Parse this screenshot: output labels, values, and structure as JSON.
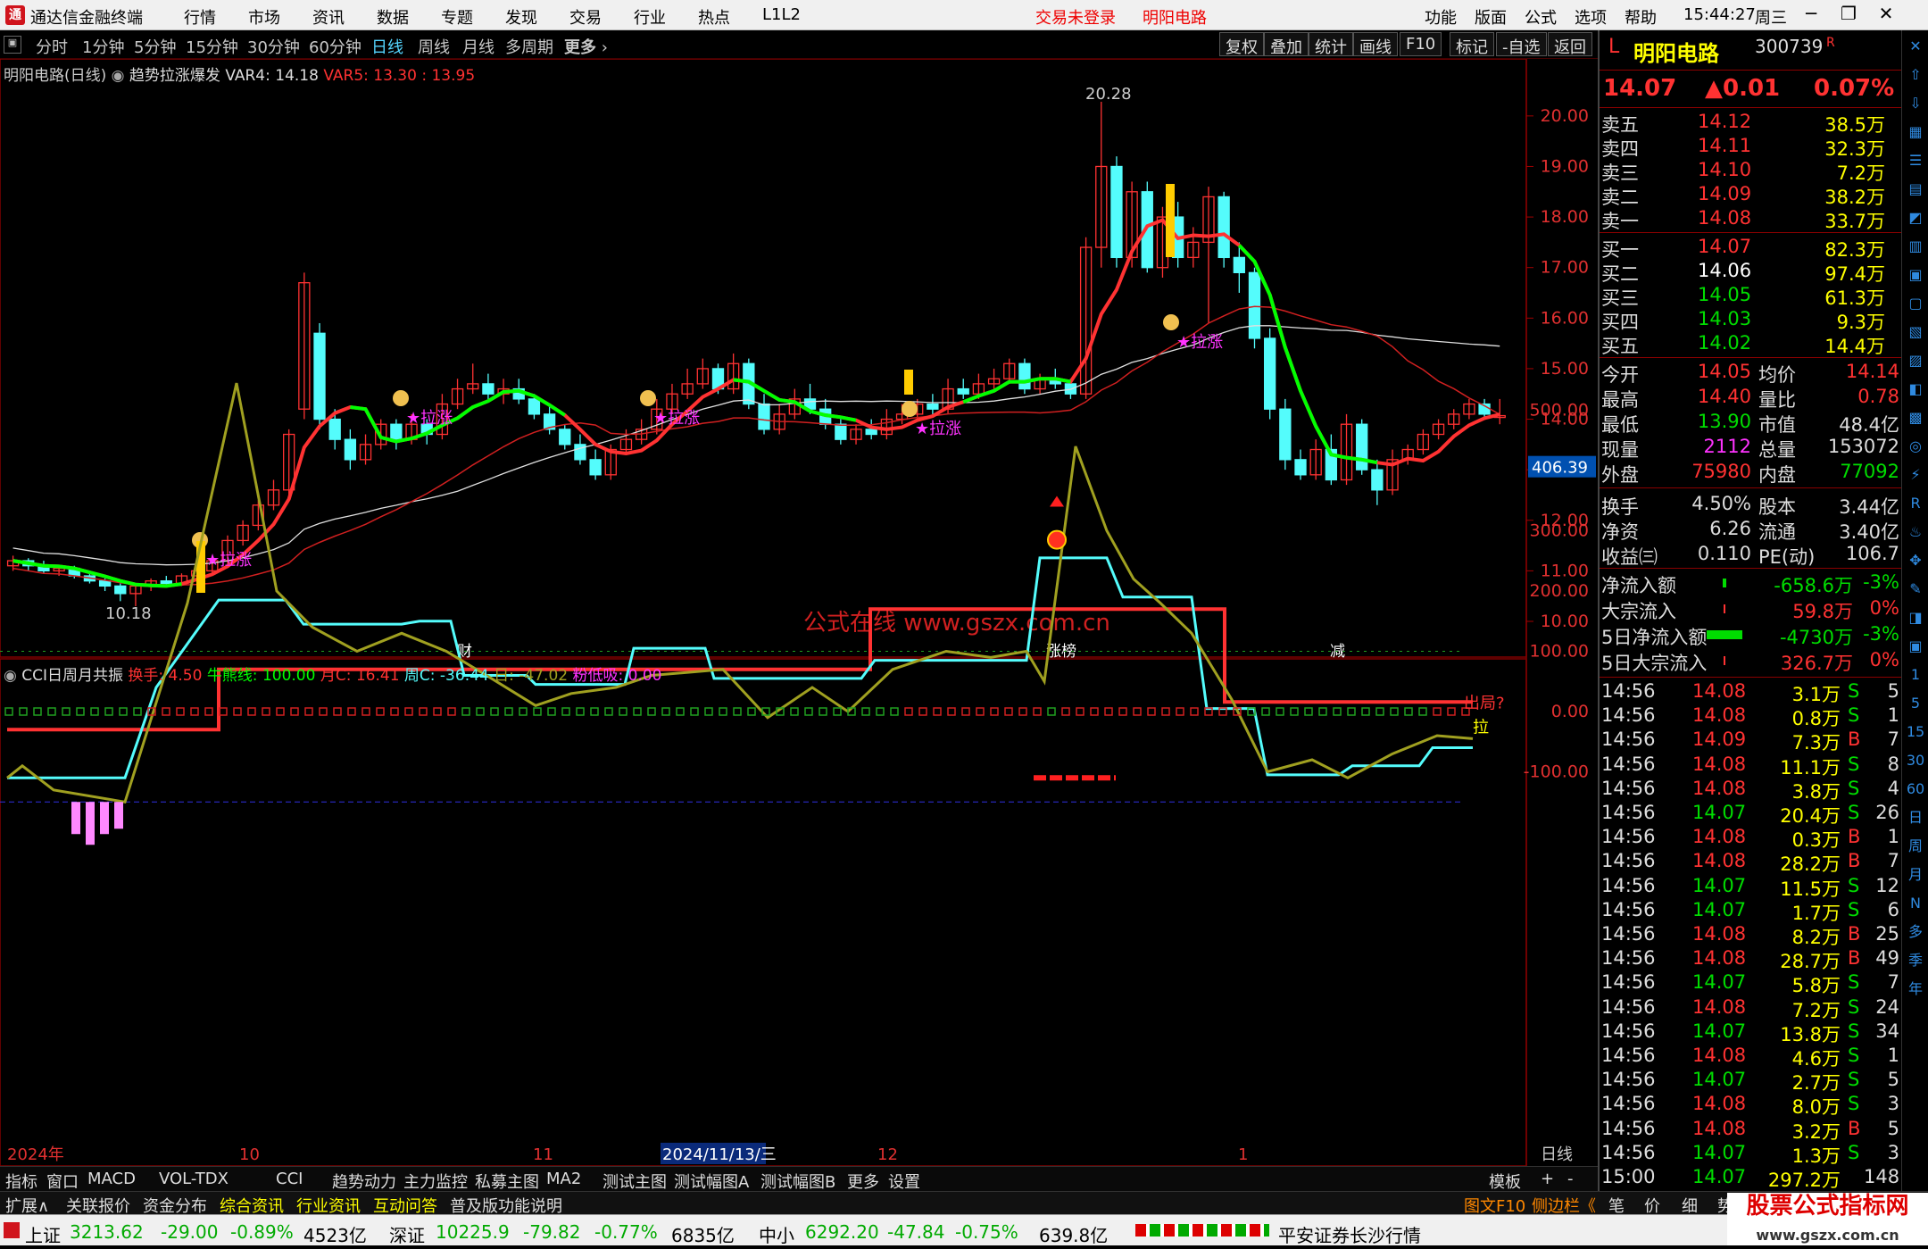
{
  "app": {
    "name": "通达信金融终端",
    "menus": [
      "行情",
      "市场",
      "资讯",
      "数据",
      "专题",
      "发现",
      "交易",
      "行业",
      "热点",
      "L1L2"
    ],
    "login_status": "交易未登录",
    "stock_title": "明阳电路",
    "right_menus": [
      "功能",
      "版面",
      "公式",
      "选项",
      "帮助"
    ],
    "time": "15:44:27",
    "weekday": "周三"
  },
  "toolbar": {
    "periods": [
      "分时",
      "1分钟",
      "5分钟",
      "15分钟",
      "30分钟",
      "60分钟",
      "日线",
      "周线",
      "月线",
      "多周期",
      "更多"
    ],
    "active": "日线",
    "tools": [
      "复权",
      "叠加",
      "统计",
      "画线",
      "F10",
      "标记",
      "-自选",
      "返回"
    ]
  },
  "main_chart": {
    "stock_label": "明阳电路(日线)",
    "indicator": "趋势拉涨爆发",
    "var4": "VAR4: 14.18",
    "var5": "VAR5: 13.30",
    "var5_tail": ": 13.95",
    "high_label": "20.28",
    "low_label": "10.18",
    "y_ticks": [
      "20.00",
      "19.00",
      "18.00",
      "17.00",
      "16.00",
      "15.00",
      "14.00",
      "13.00",
      "12.00",
      "11.00",
      "10.00"
    ],
    "signal_label": "★拉涨",
    "watermark": "公式在线  www.gszx.com.cn",
    "events": [
      "财",
      "涨榜",
      "减"
    ]
  },
  "sub_chart": {
    "title": "CCI日周月共振",
    "huanshou": "换手: 4.50",
    "niuxiong": "牛熊线: 100.00",
    "monthC": "月C: 16.41",
    "weekC": "周C: -36.44",
    "dayC": "日: -47.02",
    "fendixi": "粉低吸: 0.00",
    "y_ticks": [
      "500.00",
      "400.00",
      "300.00",
      "200.00",
      "100.00",
      "0.00",
      "-100.00"
    ],
    "current_value": "406.39",
    "label_chuju": "出局?",
    "label_la": "拉",
    "x_labels": [
      "2024年",
      "10",
      "11",
      "2024/11/13/三",
      "12",
      "1"
    ],
    "period": "日线"
  },
  "quote": {
    "name": "明阳电路",
    "code": "300739",
    "price": "14.07",
    "change": "▲0.01",
    "pct": "0.07%",
    "asks": [
      {
        "label": "卖五",
        "price": "14.12",
        "vol": "38.5万"
      },
      {
        "label": "卖四",
        "price": "14.11",
        "vol": "32.3万"
      },
      {
        "label": "卖三",
        "price": "14.10",
        "vol": "7.2万"
      },
      {
        "label": "卖二",
        "price": "14.09",
        "vol": "38.2万"
      },
      {
        "label": "卖一",
        "price": "14.08",
        "vol": "33.7万"
      }
    ],
    "bids": [
      {
        "label": "买一",
        "price": "14.07",
        "vol": "82.3万"
      },
      {
        "label": "买二",
        "price": "14.06",
        "vol": "97.4万"
      },
      {
        "label": "买三",
        "price": "14.05",
        "vol": "61.3万"
      },
      {
        "label": "买四",
        "price": "14.03",
        "vol": "9.3万"
      },
      {
        "label": "买五",
        "price": "14.02",
        "vol": "14.4万"
      }
    ],
    "stats": [
      {
        "l1": "今开",
        "v1": "14.05",
        "l2": "均价",
        "v2": "14.14"
      },
      {
        "l1": "最高",
        "v1": "14.40",
        "l2": "量比",
        "v2": "0.78"
      },
      {
        "l1": "最低",
        "v1": "13.90",
        "l2": "市值",
        "v2": "48.4亿"
      },
      {
        "l1": "现量",
        "v1": "2112",
        "l2": "总量",
        "v2": "153072"
      },
      {
        "l1": "外盘",
        "v1": "75980",
        "l2": "内盘",
        "v2": "77092"
      }
    ],
    "stats2": [
      {
        "l1": "换手",
        "v1": "4.50%",
        "l2": "股本",
        "v2": "3.44亿"
      },
      {
        "l1": "净资",
        "v1": "6.26",
        "l2": "流通",
        "v2": "3.40亿"
      },
      {
        "l1": "收益㈢",
        "v1": "0.110",
        "l2": "PE(动)",
        "v2": "106.7"
      }
    ],
    "flows": [
      {
        "label": "净流入额",
        "value": "-658.6万",
        "pct": "-3%"
      },
      {
        "label": "大宗流入",
        "value": "59.8万",
        "pct": "0%"
      },
      {
        "label": "5日净流入额",
        "value": "-4730万",
        "pct": "-3%"
      },
      {
        "label": "5日大宗流入",
        "value": "326.7万",
        "pct": "0%"
      }
    ],
    "ticks": [
      [
        "14:56",
        "14.08",
        "3.1万",
        "S",
        "5"
      ],
      [
        "14:56",
        "14.08",
        "0.8万",
        "S",
        "1"
      ],
      [
        "14:56",
        "14.09",
        "7.3万",
        "B",
        "7"
      ],
      [
        "14:56",
        "14.08",
        "11.1万",
        "S",
        "8"
      ],
      [
        "14:56",
        "14.08",
        "3.8万",
        "S",
        "4"
      ],
      [
        "14:56",
        "14.07",
        "20.4万",
        "S",
        "26"
      ],
      [
        "14:56",
        "14.08",
        "0.3万",
        "B",
        "1"
      ],
      [
        "14:56",
        "14.08",
        "28.2万",
        "B",
        "7"
      ],
      [
        "14:56",
        "14.07",
        "11.5万",
        "S",
        "12"
      ],
      [
        "14:56",
        "14.07",
        "1.7万",
        "S",
        "6"
      ],
      [
        "14:56",
        "14.08",
        "8.2万",
        "B",
        "25"
      ],
      [
        "14:56",
        "14.08",
        "28.7万",
        "B",
        "49"
      ],
      [
        "14:56",
        "14.07",
        "5.8万",
        "S",
        "7"
      ],
      [
        "14:56",
        "14.08",
        "7.2万",
        "S",
        "24"
      ],
      [
        "14:56",
        "14.07",
        "13.8万",
        "S",
        "34"
      ],
      [
        "14:56",
        "14.08",
        "4.6万",
        "S",
        "1"
      ],
      [
        "14:56",
        "14.07",
        "2.7万",
        "S",
        "5"
      ],
      [
        "14:56",
        "14.08",
        "8.0万",
        "S",
        "3"
      ],
      [
        "14:56",
        "14.08",
        "3.2万",
        "B",
        "5"
      ],
      [
        "14:56",
        "14.07",
        "1.3万",
        "S",
        "3"
      ],
      [
        "15:00",
        "14.07",
        "297.2万",
        "",
        "148"
      ]
    ]
  },
  "tabs1": [
    "指标",
    "窗口",
    "MACD",
    "VOL-TDX",
    "CCI",
    "趋势动力",
    "主力监控",
    "私募主图",
    "MA2",
    "测试主图",
    "测试幅图A",
    "测试幅图B",
    "更多",
    "设置"
  ],
  "tabs1_right": "模板",
  "tabs2": [
    "扩展∧",
    "关联报价",
    "资金分布",
    "综合资讯",
    "行业资讯",
    "互动问答",
    "普及版功能说明"
  ],
  "tabs2_right": [
    "图文F10",
    "侧边栏《",
    "笔",
    "价",
    "细",
    "势",
    "联",
    "值",
    "主"
  ],
  "status": {
    "sh_label": "上证",
    "sh": "3213.62",
    "sh_ch": "-29.00",
    "sh_pct": "-0.89%",
    "sh_amt": "4523亿",
    "sz_label": "深证",
    "sz": "10225.9",
    "sz_ch": "-79.82",
    "sz_pct": "-0.77%",
    "sz_amt": "6835亿",
    "zx_label": "中小",
    "zx": "6292.20",
    "zx_ch": "-47.84",
    "zx_pct": "-0.75%",
    "zx_amt": "639.8亿",
    "broker": "平安证券长沙行情"
  },
  "brand": "股票公式指标网",
  "brand_url": "www.gszx.com.cn",
  "colors": {
    "up": "#ff3232",
    "down": "#54fcfc",
    "green": "#00ff00",
    "yellow": "#ffff00",
    "magenta": "#ff33ff"
  }
}
